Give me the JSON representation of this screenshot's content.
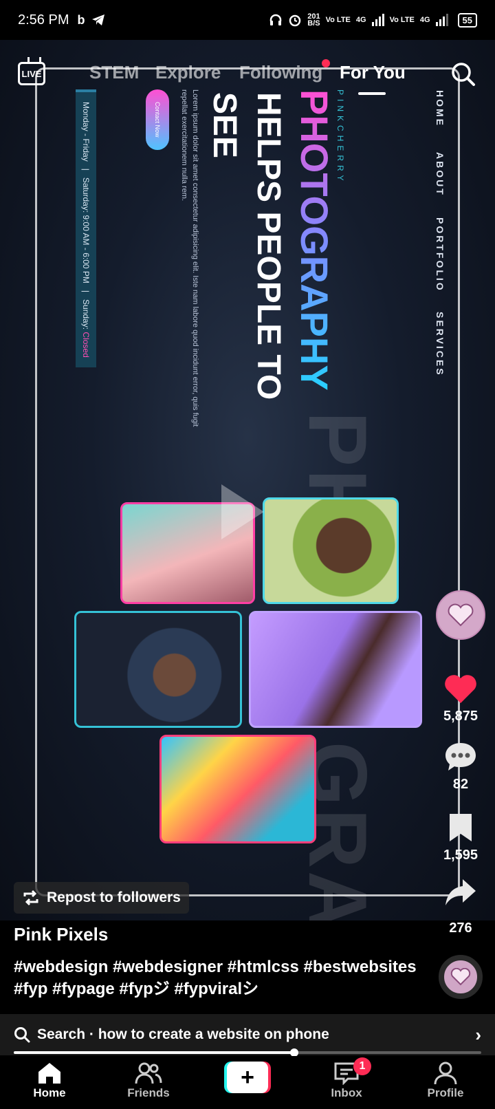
{
  "status_bar": {
    "time": "2:56 PM",
    "left_icons": [
      "b-icon",
      "telegram-icon"
    ],
    "net_speed_top": "201",
    "net_speed_bottom": "B/S",
    "sim1": "Vo LTE",
    "sim1_net": "4G",
    "sim2": "Vo LTE",
    "sim2_net": "4G",
    "battery": "55"
  },
  "top_tabs": {
    "live_label": "LIVE",
    "tabs": [
      "STEM",
      "Explore",
      "Following",
      "For You"
    ],
    "active_tab": "For You"
  },
  "video_content": {
    "nav_items": [
      "HOME",
      "ABOUT",
      "PORTFOLIO",
      "SERVICES"
    ],
    "brand": "PINKCHERRY",
    "headline_1": "PHOTOGRAPHY",
    "headline_2": "HELPS PEOPLE TO",
    "headline_3": "SEE",
    "body": "Lorem ipsum dolor sit amet consectetur adipisicing elit. Iste nam labore quod incidunt error, quis fugit repellat exercitationem nulla rem.",
    "cta": "Contact Now",
    "hours_1": "Monday - Friday",
    "hours_2": "Saturday: 9:00 AM - 6:00 PM",
    "hours_3_prefix": "Sunday:",
    "hours_3_status": "Closed",
    "bg_word_1": "PHO",
    "bg_word_2": "GRA"
  },
  "actions": {
    "likes": "5,875",
    "comments": "82",
    "saves": "1,595",
    "shares": "276"
  },
  "repost_label": "Repost to followers",
  "caption": {
    "author": "Pink Pixels",
    "hashtags": "#webdesign #webdesigner #htmlcss #bestwebsites #fyp #fypage #fypジ #fypviralシ"
  },
  "search_suggestion": "Search · how to create a website on phone",
  "progress": 0.6,
  "bottom_nav": {
    "home": "Home",
    "friends": "Friends",
    "inbox": "Inbox",
    "profile": "Profile",
    "inbox_badge": "1"
  },
  "colors": {
    "accent_red": "#fe2c55",
    "accent_cyan": "#25f4ee",
    "like_red": "#fe2c55"
  }
}
